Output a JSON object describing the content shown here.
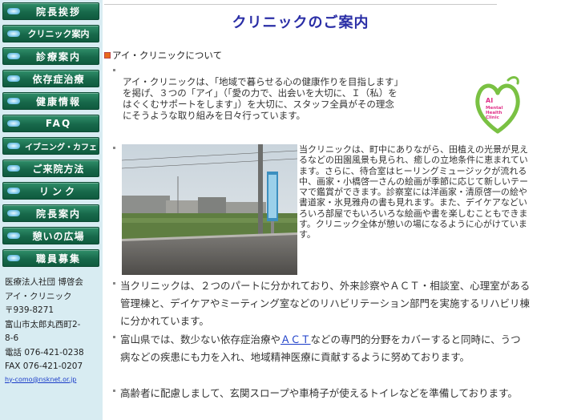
{
  "sidebar": {
    "nav": [
      {
        "label": "院長挨拶"
      },
      {
        "label": "クリニック案内"
      },
      {
        "label": "診療案内"
      },
      {
        "label": "依存症治療"
      },
      {
        "label": "健康情報"
      },
      {
        "label": "FAQ"
      },
      {
        "label": "イブニング・カフェ"
      },
      {
        "label": "ご来院方法"
      },
      {
        "label": "リンク"
      },
      {
        "label": "院長案内"
      },
      {
        "label": "憩いの広場"
      },
      {
        "label": "職員募集"
      }
    ],
    "address": {
      "corp": "医療法人社団 博啓会",
      "name": "アイ・クリニック",
      "postal": "〒939-8271",
      "street1": "富山市太郎丸西町2-",
      "street2": "8-6",
      "tel": "電話 076-421-0238",
      "fax": "FAX 076-421-0207",
      "email": "hy-como@nsknet.or.jp"
    }
  },
  "main": {
    "title": "クリニックのご案内",
    "section": "アイ・クリニックについて",
    "intro": "アイ・クリニックは、「地域で暮らせる心の健康作りを目指します」を掲げ、３つの「アイ」（「愛の力で、出会いを大切に、Ｉ（私）をはぐくむサポートをします」）を大切に、スタッフ全員がその理念にそうような取り組みを日々行っています。",
    "location": "当クリニックは、町中にありながら、田植えの光景が見えるなどの田園風景も見られ、癒しの立地条件に恵まれています。さらに、待合室はヒーリングミュージックが流れる中、画家・小橋啓一さんの絵画が季節に応じて新しいテーマで鑑賞ができます。診察室には洋画家・清原啓一の絵や書道家・氷見雅舟の書も見れます。また、デイケアなどいろいろ部屋でもいろいろな絵画や書を楽しむこともできます。クリニック全体が憩いの場になるように心がけています。",
    "parts": "当クリニックは、２つのパートに分かれており、外来診察やＡＣＴ・相談室、心理室がある管理棟と、デイケアやミーティング室などのリハビリテーション部門を実施するリハビリ棟に分かれています。",
    "toyama_before": "富山県では、数少ない依存症治療や",
    "toyama_link": "ＡＣＴ",
    "toyama_after": "などの専門的分野をカバーすると同時に、うつ病などの疾患にも力を入れ、地域精神医療に貢献するように努めております。",
    "barrier": "高齢者に配慮しまして、玄関スロープや車椅子が使えるトイレなどを準備しております。",
    "logo_text": [
      "AI",
      "Mental",
      "Health",
      "Clinic"
    ]
  },
  "colors": {
    "nav_green": "#18694b",
    "sidebar_bg": "#d8ecf2",
    "title_blue": "#2a2ea6",
    "link_blue": "#1a3cc8",
    "logo_green": "#7ac143",
    "logo_pink": "#e0338a"
  },
  "icons": {
    "nav_bullet": "pill-dot-icon",
    "section_marker": "orange-square-icon",
    "list_bullet": "gray-dot-icon"
  }
}
